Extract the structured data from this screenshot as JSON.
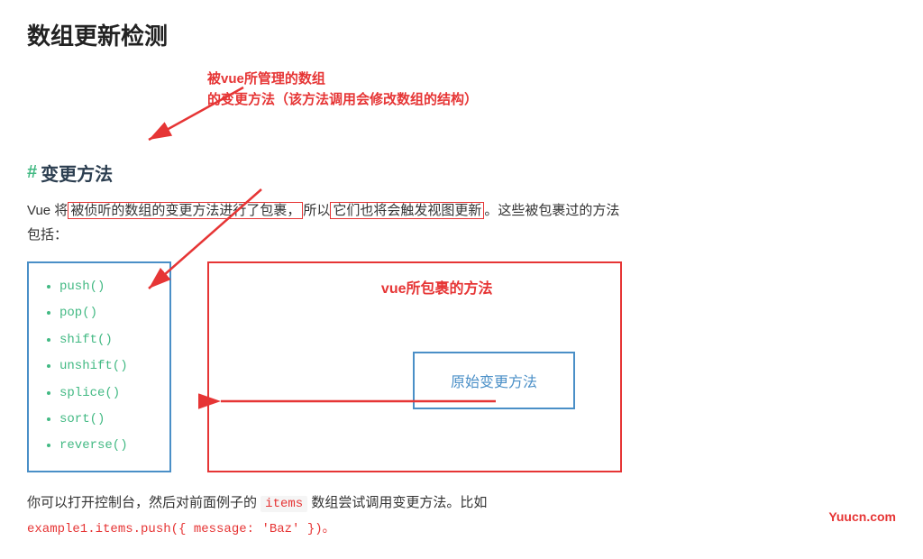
{
  "page": {
    "title": "数组更新检测",
    "section_heading_hash": "#",
    "section_heading_text": "变更方法",
    "annotation_text": "被vue所管理的数组\n的变更方法（该方法调用会修改数组的结构）",
    "description_line1": "Vue 将",
    "description_highlight1": "被侦听的数组的变更方法进行了包裹，",
    "description_mid": "所以",
    "description_highlight2": "它们也将会触发视图更新",
    "description_end": "。这些被包裹过的方法\n包括：",
    "methods": [
      "push()",
      "pop()",
      "shift()",
      "unshift()",
      "splice()",
      "sort()",
      "reverse()"
    ],
    "vue_wrapper_label": "vue所包裹的方法",
    "original_method_label": "原始变更方法",
    "bottom_text1": "你可以打开控制台，然后对前面例子的 ",
    "bottom_items_code": "items",
    "bottom_text2": " 数组尝试调用变更方法。比如",
    "bottom_code": "example1.items.push({ message: 'Baz' })。",
    "watermark": "Yuucn.com"
  }
}
